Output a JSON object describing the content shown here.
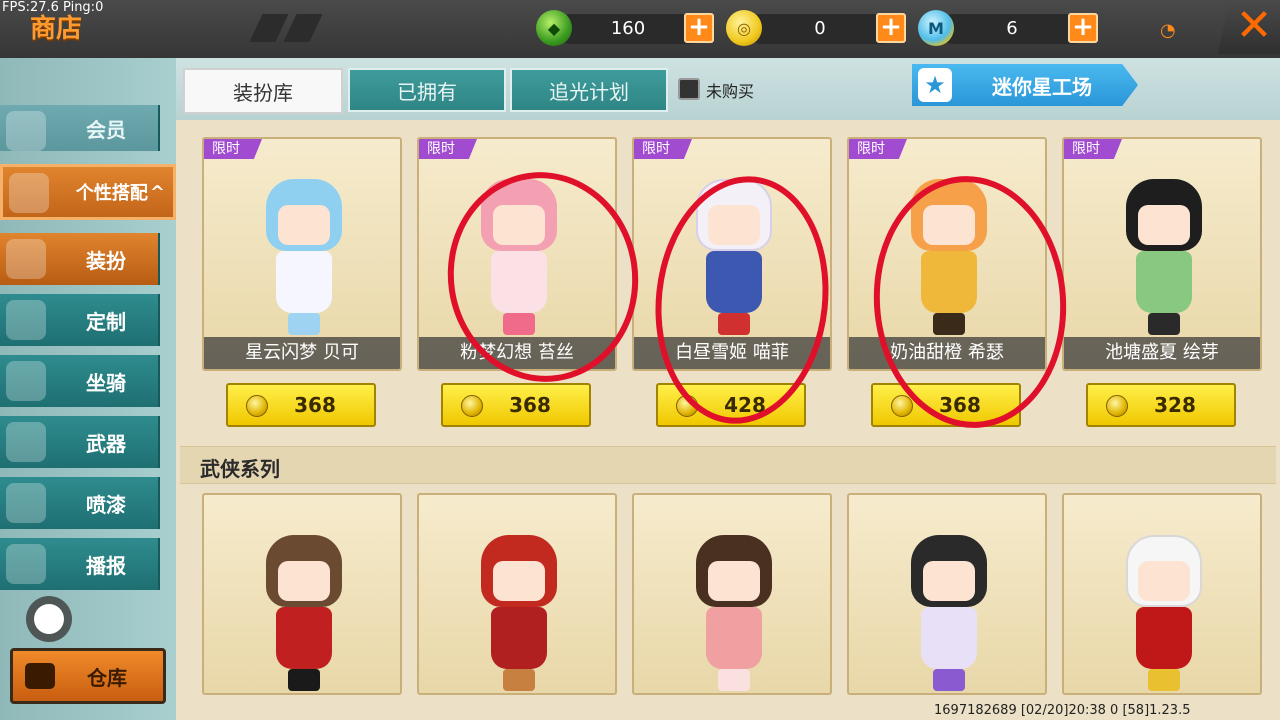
{
  "debug": {
    "fps": "FPS:27.6  Ping:0"
  },
  "header": {
    "title": "商店",
    "currencies": [
      {
        "name": "gem",
        "value": "160",
        "icon": "green-gem-icon",
        "color": "#4aa82a"
      },
      {
        "name": "coin",
        "value": "0",
        "icon": "gold-coin-icon",
        "color": "#f0c81e"
      },
      {
        "name": "mini-coin",
        "value": "6",
        "icon": "mini-coin-icon",
        "color": "#4fbde8"
      }
    ],
    "plus_label": "+",
    "close_label": "✕"
  },
  "sidebar": {
    "member": "会员",
    "category": "个性搭配",
    "category_arrow": "^",
    "items": [
      {
        "label": "装扮",
        "active": true
      },
      {
        "label": "定制",
        "active": false
      },
      {
        "label": "坐骑",
        "active": false
      },
      {
        "label": "武器",
        "active": false
      },
      {
        "label": "喷漆",
        "active": false
      },
      {
        "label": "播报",
        "active": false
      }
    ],
    "warehouse": "仓库"
  },
  "tabs": [
    {
      "label": "装扮库",
      "active": true
    },
    {
      "label": "已拥有",
      "active": false
    },
    {
      "label": "追光计划",
      "active": false
    }
  ],
  "filter": {
    "label": "未购买",
    "checked": false
  },
  "workshop": {
    "label": "迷你星工场",
    "icon": "star-icon"
  },
  "row1": {
    "badge": "限时",
    "items": [
      {
        "name": "星云闪梦 贝可",
        "price": "368",
        "hair": "#8fd0f0",
        "outfit": "#f6f6ff",
        "accent": "#9ed4f2"
      },
      {
        "name": "粉梦幻想 苔丝",
        "price": "368",
        "hair": "#f2a0b2",
        "outfit": "#fbe0e6",
        "accent": "#f06a8a"
      },
      {
        "name": "白昼雪姬 喵菲",
        "price": "428",
        "hair": "#f4f0f8",
        "outfit": "#3c58b0",
        "accent": "#d03030"
      },
      {
        "name": "奶油甜橙 希瑟",
        "price": "368",
        "hair": "#f6a04a",
        "outfit": "#f0b83a",
        "accent": "#3a2a1a"
      },
      {
        "name": "池塘盛夏 绘芽",
        "price": "328",
        "hair": "#1e1e1e",
        "outfit": "#88c880",
        "accent": "#2a2a2a"
      }
    ]
  },
  "section2": {
    "title": "武侠系列",
    "items": [
      {
        "hair": "#6a4a30",
        "outfit": "#c02020",
        "accent": "#1a1a1a"
      },
      {
        "hair": "#c22a20",
        "outfit": "#b02020",
        "accent": "#c88040"
      },
      {
        "hair": "#4a3020",
        "outfit": "#f0a0a0",
        "accent": "#fbe0e0"
      },
      {
        "hair": "#2a2a2a",
        "outfit": "#e8e0f6",
        "accent": "#8a5ad0"
      },
      {
        "hair": "#f6f6f6",
        "outfit": "#c01818",
        "accent": "#e8c030"
      }
    ]
  },
  "footer": {
    "info": "1697182689      [02/20]20:38 0  [58]1.23.5"
  }
}
